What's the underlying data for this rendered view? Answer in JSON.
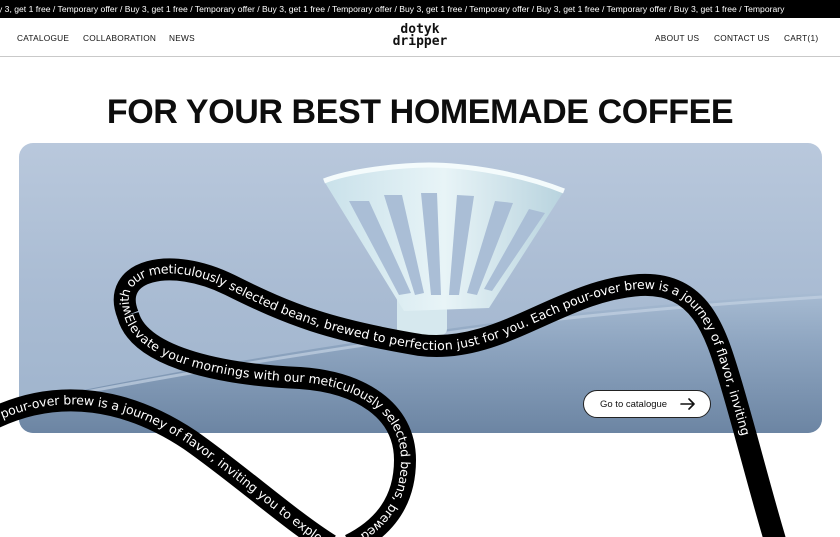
{
  "promo": {
    "ticker_text": "y 3, get 1 free / Temporary offer / Buy 3, get 1 free / Temporary offer / Buy 3, get 1 free / Temporary offer / Buy 3, get 1 free / Temporary offer / Buy 3, get 1 free / Temporary offer / Buy 3, get 1 free / Temporary"
  },
  "nav": {
    "left": [
      "CATALOGUE",
      "COLLABORATION",
      "NEWS"
    ],
    "right": [
      "ABOUT US",
      "CONTACT US",
      "CART(1)"
    ]
  },
  "brand": {
    "line1": "dotyk",
    "line2": "dripper"
  },
  "hero": {
    "headline": "FOR YOUR BEST HOMEMADE COFFEE",
    "cta_label": "Go to catalogue"
  },
  "ribbon": {
    "text": "with our meticulously selected beans, brewed to perfection just for you. Each pour-over brew is a journey of flavor, inviting",
    "text_b": "Elevate your mornings with our meticulously selected beans, brewed to perfection just for you. Each pour-over brew is a journey of flavor, inviting you to explore richness and depth in every sip. Elevate your mornings",
    "text_c": "n pour-over brew is a journey of flavor, inviting you to explore richness and depth in every sip."
  },
  "icons": {
    "cta": "arrow-right-icon"
  }
}
